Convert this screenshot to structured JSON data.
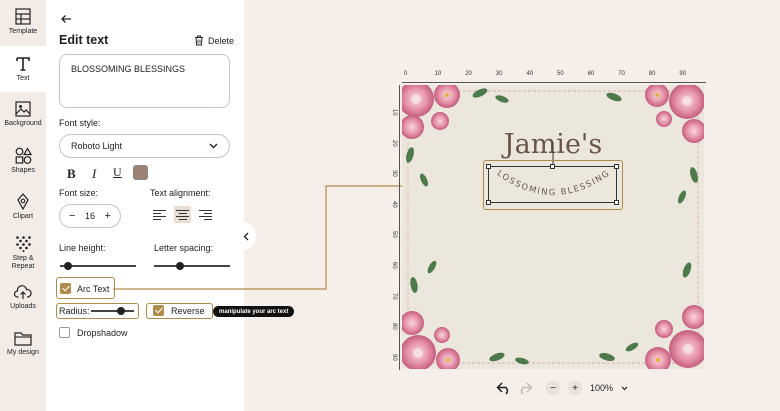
{
  "rail": {
    "items": [
      {
        "label": "Template",
        "icon": "template-icon"
      },
      {
        "label": "Text",
        "icon": "text-icon"
      },
      {
        "label": "Background",
        "icon": "background-icon"
      },
      {
        "label": "Shapes",
        "icon": "shapes-icon"
      },
      {
        "label": "Clipart",
        "icon": "clipart-icon"
      },
      {
        "label": "Step &\nRepeat",
        "icon": "step-repeat-icon"
      },
      {
        "label": "Uploads",
        "icon": "uploads-icon"
      },
      {
        "label": "My design",
        "icon": "my-design-icon"
      }
    ],
    "active": "Text"
  },
  "panel": {
    "title": "Edit text",
    "delete_label": "Delete",
    "text_value": "BLOSSOMING BLESSINGS",
    "font_style_label": "Font style:",
    "font_name": "Roboto Light",
    "bold_label": "B",
    "italic_label": "I",
    "underline_label": "U",
    "text_color": "#9c8272",
    "font_size_label": "Font size:",
    "font_size_value": "16",
    "text_alignment_label": "Text alignment:",
    "alignment": "center",
    "line_height_label": "Line height:",
    "line_height_value": 0.06,
    "letter_spacing_label": "Letter spacing:",
    "letter_spacing_value": 0.32,
    "arc_text_label": "Arc Text",
    "arc_text_checked": true,
    "radius_label": "Radius:",
    "radius_value": 0.75,
    "reverse_label": "Reverse",
    "reverse_checked": true,
    "dropshadow_label": "Dropshadow",
    "dropshadow_checked": false,
    "tooltip": "manipulate your arc text"
  },
  "canvas": {
    "ruler_top": [
      "0",
      "10",
      "20",
      "30",
      "40",
      "50",
      "60",
      "70",
      "80",
      "90"
    ],
    "ruler_left": [
      "10",
      "20",
      "30",
      "40",
      "50",
      "60",
      "70",
      "80",
      "90"
    ],
    "title_text": "Jamie's",
    "arc_text": "BLOSSOMING BLESSINGS",
    "accent": "#b08c4a"
  },
  "footer": {
    "zoom_minus": "−",
    "zoom_plus": "+",
    "zoom_level": "100%"
  }
}
